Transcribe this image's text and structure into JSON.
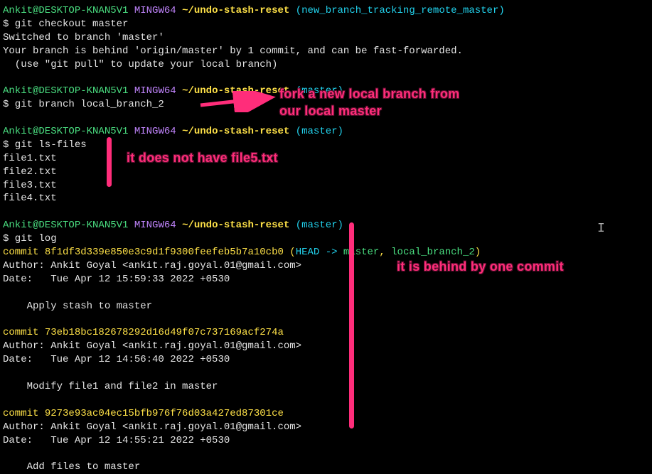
{
  "prompt1": {
    "user_host": "Ankit@DESKTOP-KNAN5V1",
    "env": "MINGW64",
    "path": "~/undo-stash-reset",
    "branch": "(new_branch_tracking_remote_master)"
  },
  "cmd1": "$ git checkout master",
  "out1_l1": "Switched to branch 'master'",
  "out1_l2": "Your branch is behind 'origin/master' by 1 commit, and can be fast-forwarded.",
  "out1_l3": "  (use \"git pull\" to update your local branch)",
  "prompt2": {
    "user_host": "Ankit@DESKTOP-KNAN5V1",
    "env": "MINGW64",
    "path": "~/undo-stash-reset",
    "branch": "(master)"
  },
  "cmd2": "$ git branch local_branch_2",
  "prompt3": {
    "user_host": "Ankit@DESKTOP-KNAN5V1",
    "env": "MINGW64",
    "path": "~/undo-stash-reset",
    "branch": "(master)"
  },
  "cmd3": "$ git ls-files",
  "files": {
    "f1": "file1.txt",
    "f2": "file2.txt",
    "f3": "file3.txt",
    "f4": "file4.txt"
  },
  "prompt4": {
    "user_host": "Ankit@DESKTOP-KNAN5V1",
    "env": "MINGW64",
    "path": "~/undo-stash-reset",
    "branch": "(master)"
  },
  "cmd4": "$ git log",
  "commit1": {
    "prefix": "commit ",
    "hash": "8f1df3d339e850e3c9d1f9300feefeb5b7a10cb0",
    "open": " (",
    "head": "HEAD -> ",
    "b1": "master",
    "sep": ", ",
    "b2": "local_branch_2",
    "close": ")",
    "author": "Author: Ankit Goyal <ankit.raj.goyal.01@gmail.com>",
    "date": "Date:   Tue Apr 12 15:59:33 2022 +0530",
    "msg": "    Apply stash to master"
  },
  "commit2": {
    "prefix": "commit ",
    "hash": "73eb18bc182678292d16d49f07c737169acf274a",
    "author": "Author: Ankit Goyal <ankit.raj.goyal.01@gmail.com>",
    "date": "Date:   Tue Apr 12 14:56:40 2022 +0530",
    "msg": "    Modify file1 and file2 in master"
  },
  "commit3": {
    "prefix": "commit ",
    "hash": "9273e93ac04ec15bfb976f76d03a427ed87301ce",
    "author": "Author: Ankit Goyal <ankit.raj.goyal.01@gmail.com>",
    "date": "Date:   Tue Apr 12 14:55:21 2022 +0530",
    "msg": "    Add files to master"
  },
  "annotations": {
    "fork_l1": "fork a new local branch from",
    "fork_l2": "our local master",
    "no_file5": "it does not have file5.txt",
    "behind": "it is behind by one commit"
  }
}
